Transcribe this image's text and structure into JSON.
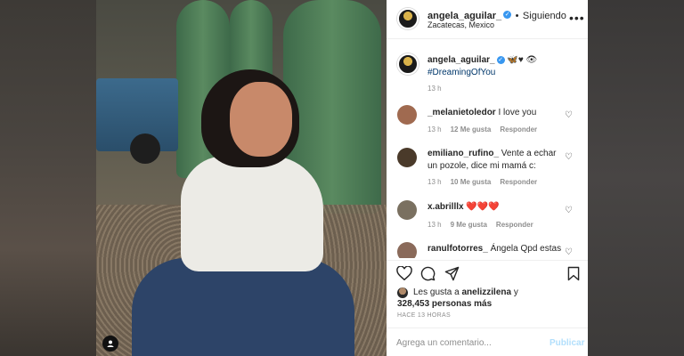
{
  "header": {
    "username": "angela_aguilar_",
    "separator": "•",
    "follow_label": "Siguiendo",
    "location": "Zacatecas, Mexico",
    "more_icon": "more-horizontal-icon"
  },
  "caption": {
    "username": "angela_aguilar_",
    "text": "🦋♥ 👁",
    "hashtag": "#DreamingOfYou",
    "time": "13 h"
  },
  "comments": [
    {
      "username": "_melanietoledor",
      "text": "I love you",
      "time": "13 h",
      "likes": "12 Me gusta",
      "reply": "Responder",
      "avatar_color": "#a06a50"
    },
    {
      "username": "emiliano_rufino_",
      "text": "Vente a echar un pozole, dice mi mamá c:",
      "time": "13 h",
      "likes": "10 Me gusta",
      "reply": "Responder",
      "avatar_color": "#4a3a2a"
    },
    {
      "username": "x.abrilllx",
      "text": "❤️❤️❤️",
      "time": "13 h",
      "likes": "9 Me gusta",
      "reply": "Responder",
      "avatar_color": "#7a7060"
    },
    {
      "username": "ranulfotorres_",
      "text": "Ángela Qpd estas",
      "time": "",
      "likes": "",
      "reply": "",
      "avatar_color": "#8a6a5a"
    }
  ],
  "likes": {
    "prefix": "Les gusta a ",
    "user": "anelizzilena",
    "middle": " y",
    "count": "328,453 personas más"
  },
  "timeago": "HACE 13 HORAS",
  "add_comment": {
    "placeholder": "Agrega un comentario...",
    "publish_label": "Publicar"
  },
  "colors": {
    "accent_blue": "#3897f0",
    "publish_disabled": "#b2dffc",
    "text": "#262626",
    "muted": "#8e8e8e"
  }
}
